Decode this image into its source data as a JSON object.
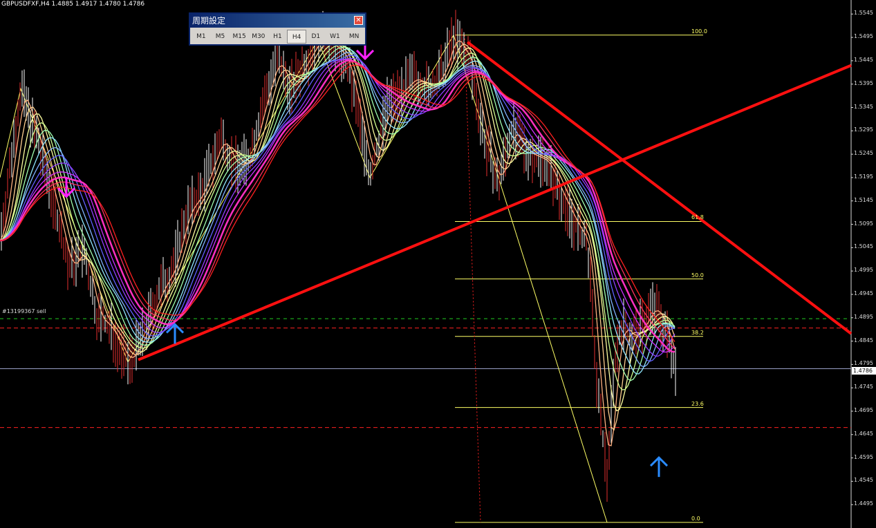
{
  "symbol_info": "GBPUSDFXF,H4  1.4885 1.4917 1.4780 1.4786",
  "order_label": "#13199367 sell",
  "current_price": "1.4786",
  "panel": {
    "title": "周期設定",
    "close_icon": "close-icon",
    "timeframes": [
      "M1",
      "M5",
      "M15",
      "M30",
      "H1",
      "H4",
      "D1",
      "W1",
      "MN"
    ],
    "selected": "H4"
  },
  "price_ticks": [
    "1.5545",
    "1.5495",
    "1.5445",
    "1.5395",
    "1.5345",
    "1.5295",
    "1.5245",
    "1.5195",
    "1.5145",
    "1.5095",
    "1.5045",
    "1.4995",
    "1.4945",
    "1.4895",
    "1.4845",
    "1.4795",
    "1.4745",
    "1.4695",
    "1.4645",
    "1.4595",
    "1.4545",
    "1.4495"
  ],
  "fib_levels": [
    {
      "label": "100.0",
      "price": 1.55
    },
    {
      "label": "61.8",
      "price": 1.5101
    },
    {
      "label": "50.0",
      "price": 1.4978
    },
    {
      "label": "38.2",
      "price": 1.4855
    },
    {
      "label": "23.6",
      "price": 1.4703
    },
    {
      "label": "0.0",
      "price": 1.4457
    }
  ],
  "colors": {
    "background": "#000000",
    "candles": "#e63030",
    "trendline": "#ff1010",
    "fib": "#ffff66",
    "arrow_up": "#2a8cff",
    "arrow_down": "#ff22ff"
  },
  "chart_data": {
    "type": "line",
    "title": "",
    "ylim": [
      1.4445,
      1.5575
    ],
    "close_price": 1.4786,
    "horizontal_lines": [
      {
        "price": 1.4893,
        "style": "dash-green"
      },
      {
        "price": 1.4873,
        "style": "dash-red"
      },
      {
        "price": 1.4786,
        "style": "solid-white"
      },
      {
        "price": 1.466,
        "style": "dash-red"
      }
    ],
    "trendlines": [
      {
        "from": [
          200,
          1.4805
        ],
        "to": [
          1231,
          1.5435
        ]
      },
      {
        "from": [
          676,
          1.5485
        ],
        "to": [
          1231,
          1.4861
        ]
      }
    ],
    "arrows_up": [
      [
        253,
        1.486
      ],
      [
        953,
        1.4575
      ]
    ],
    "arrows_down": [
      [
        96,
        1.5175
      ],
      [
        528,
        1.547
      ]
    ],
    "price_path": [
      [
        0,
        1.506
      ],
      [
        30,
        1.5385
      ],
      [
        55,
        1.527
      ],
      [
        80,
        1.513
      ],
      [
        100,
        1.5
      ],
      [
        120,
        1.504
      ],
      [
        140,
        1.49
      ],
      [
        160,
        1.487
      ],
      [
        185,
        1.48
      ],
      [
        205,
        1.485
      ],
      [
        230,
        1.495
      ],
      [
        250,
        1.5
      ],
      [
        270,
        1.512
      ],
      [
        290,
        1.516
      ],
      [
        320,
        1.528
      ],
      [
        340,
        1.522
      ],
      [
        360,
        1.523
      ],
      [
        380,
        1.535
      ],
      [
        400,
        1.545
      ],
      [
        420,
        1.538
      ],
      [
        440,
        1.544
      ],
      [
        460,
        1.549
      ],
      [
        480,
        1.548
      ],
      [
        500,
        1.545
      ],
      [
        520,
        1.532
      ],
      [
        535,
        1.5195
      ],
      [
        560,
        1.535
      ],
      [
        580,
        1.538
      ],
      [
        600,
        1.541
      ],
      [
        620,
        1.538
      ],
      [
        640,
        1.542
      ],
      [
        656,
        1.55
      ],
      [
        680,
        1.544
      ],
      [
        700,
        1.528
      ],
      [
        720,
        1.518
      ],
      [
        740,
        1.53
      ],
      [
        760,
        1.525
      ],
      [
        790,
        1.523
      ],
      [
        810,
        1.516
      ],
      [
        830,
        1.51
      ],
      [
        850,
        1.505
      ],
      [
        865,
        1.472
      ],
      [
        878,
        1.456
      ],
      [
        890,
        1.482
      ],
      [
        900,
        1.488
      ],
      [
        915,
        1.485
      ],
      [
        930,
        1.488
      ],
      [
        945,
        1.492
      ],
      [
        960,
        1.488
      ],
      [
        978,
        1.4786
      ]
    ],
    "ma_ribbon": [
      {
        "color": "#ffb080",
        "offset": 0.0
      },
      {
        "color": "#ffd090",
        "offset": 0.0008
      },
      {
        "color": "#ffffa0",
        "offset": 0.0016
      },
      {
        "color": "#d0ff90",
        "offset": 0.0024
      },
      {
        "color": "#a0ffb0",
        "offset": 0.0032
      },
      {
        "color": "#90e8ff",
        "offset": 0.004
      },
      {
        "color": "#80b0ff",
        "offset": 0.0048
      },
      {
        "color": "#6060ff",
        "offset": 0.0056
      },
      {
        "color": "#9040ff",
        "offset": 0.0064
      },
      {
        "color": "#d030ff",
        "offset": 0.0072
      },
      {
        "color": "#ff30c0",
        "offset": 0.008
      },
      {
        "color": "#ff3060",
        "offset": 0.0088
      },
      {
        "color": "#ff2020",
        "offset": 0.0096
      }
    ]
  }
}
